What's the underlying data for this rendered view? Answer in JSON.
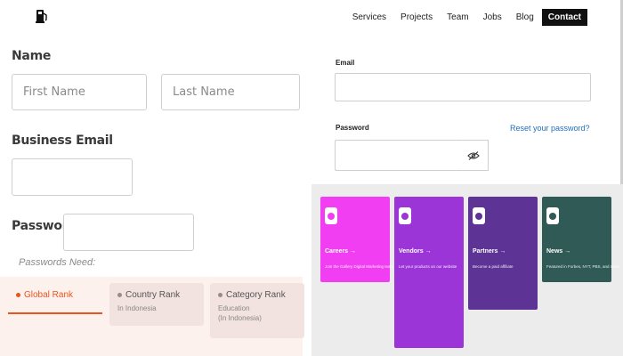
{
  "nav": {
    "items": [
      "Services",
      "Projects",
      "Team",
      "Jobs",
      "Blog"
    ],
    "active": "Contact"
  },
  "left_form": {
    "name_label": "Name",
    "first_name_placeholder": "First Name",
    "last_name_placeholder": "Last Name",
    "business_email_label": "Business Email",
    "password_label": "Password",
    "password_hint": "Passwords Need:"
  },
  "rank_tabs": [
    {
      "title": "Global Rank",
      "sub": ""
    },
    {
      "title": "Country Rank",
      "sub": "In Indonesia"
    },
    {
      "title": "Category Rank",
      "sub": "Education\n(In Indonesia)"
    }
  ],
  "right_form": {
    "email_label": "Email",
    "password_label": "Password",
    "reset_link": "Reset your password?"
  },
  "cards": [
    {
      "title": "Careers →",
      "desc": "Join the Gallery Digital Marketing team in Austin",
      "color": "#f13ef2"
    },
    {
      "title": "Vendors →",
      "desc": "Let your products on our website",
      "color": "#9b35d8"
    },
    {
      "title": "Partners →",
      "desc": "Become a paid affiliate",
      "color": "#5e3396"
    },
    {
      "title": "News →",
      "desc": "Featured in Forbes, NYT, PBS, and more",
      "color": "#2f5a55"
    }
  ],
  "colors": {
    "accent_orange": "#e8551e",
    "link_blue": "#1f6fbf"
  }
}
